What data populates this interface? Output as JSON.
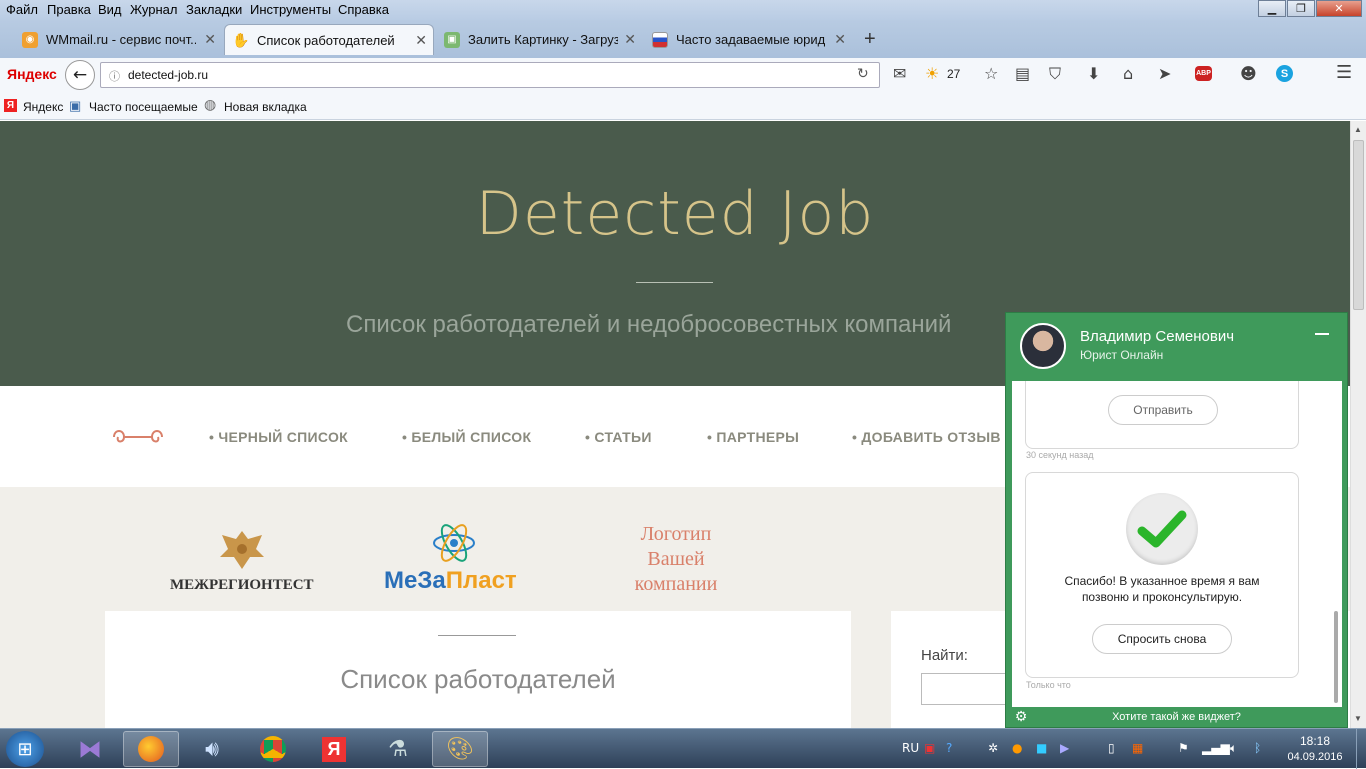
{
  "menu": [
    "Файл",
    "Правка",
    "Вид",
    "Журнал",
    "Закладки",
    "Инструменты",
    "Справка"
  ],
  "tabs": [
    {
      "label": "WMmail.ru - сервис почт...",
      "active": false
    },
    {
      "label": "Список работодателей",
      "active": true
    },
    {
      "label": "Залить Картинку - Загруз...",
      "active": false
    },
    {
      "label": "Часто задаваемые юриди...",
      "active": false
    }
  ],
  "toolbar": {
    "brand": "Яндекс",
    "url": "detected-job.ru",
    "weather": "27",
    "abp": "ABP"
  },
  "bookmarks": [
    "Яндекс",
    "Часто посещаемые",
    "Новая вкладка"
  ],
  "hero": {
    "title": "Detected Job",
    "subtitle": "Список работодателей и недобросовестных компаний"
  },
  "nav": [
    "• ЧЕРНЫЙ СПИСОК",
    "• БЕЛЫЙ СПИСОК",
    "• СТАТЬИ",
    "• ПАРТНЕРЫ",
    "• ДОБАВИТЬ ОТЗЫВ"
  ],
  "partners": {
    "p1": "МЕЖРЕГИОНТЕСТ",
    "p2a": "МеЗа",
    "p2b": "Пласт",
    "p3": [
      "Логотип",
      "Вашей",
      "компании"
    ]
  },
  "main": {
    "heading": "Список работодателей"
  },
  "sidebar": {
    "search_label": "Найти:"
  },
  "chat": {
    "name": "Владимир Семенович",
    "role": "Юрист Онлайн",
    "send_button": "Отправить",
    "ts1": "30 секунд назад",
    "message": "Спасибо! В указанное время я вам позвоню и проконсультирую.",
    "ask_again": "Спросить снова",
    "ts2": "Только что",
    "footer": "Хотите такой же виджет?"
  },
  "taskbar": {
    "lang": "RU",
    "time": "18:18",
    "date": "04.09.2016"
  }
}
